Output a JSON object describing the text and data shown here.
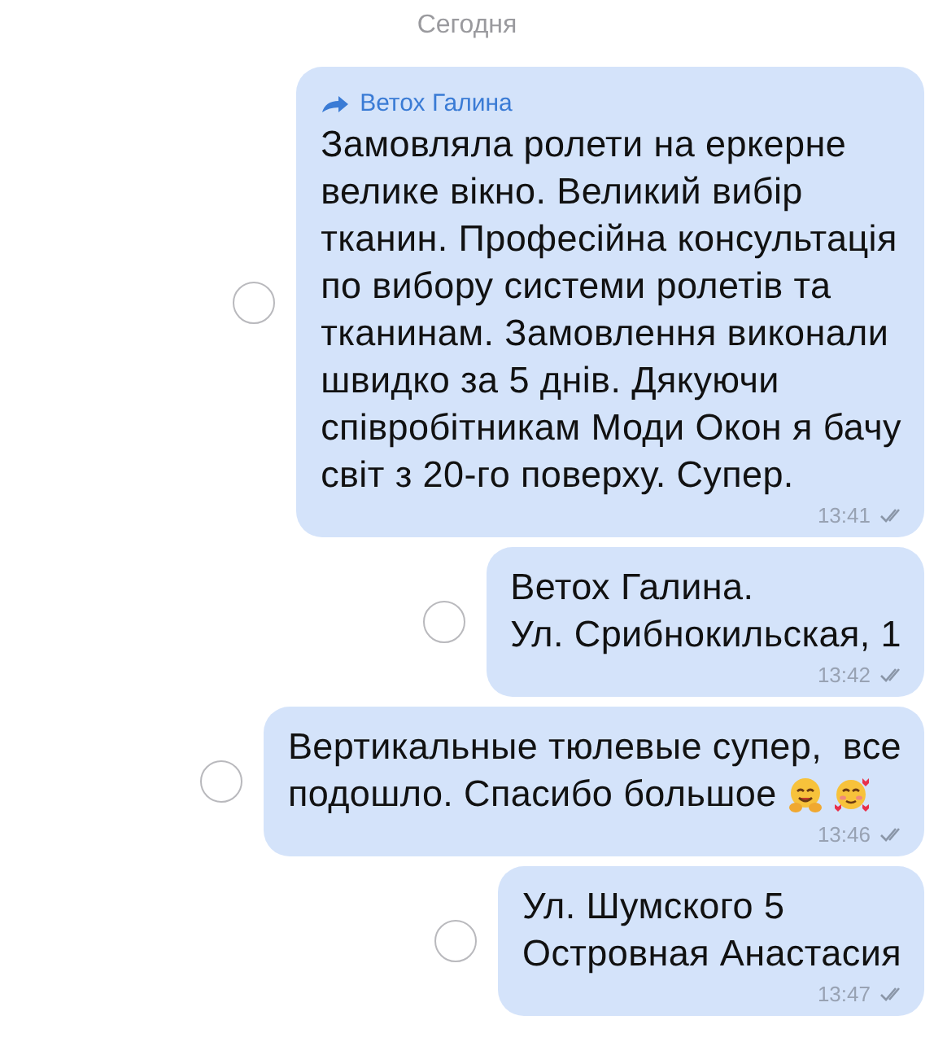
{
  "date_header": "Сегодня",
  "messages": [
    {
      "forwarded_from": "Ветох Галина",
      "text": "Замовляла ролети на еркерне\nвелике вікно. Великий вибір\nтканин. Професійна консультація\nпо вибору системи ролетів та\nтканинам. Замовлення виконали\nшвидко за 5 днів. Дякуючи\nспівробітникам Моди Окон я бачу\nсвіт з 20-го поверху. Супер.",
      "time": "13:41",
      "read": true,
      "selected": false
    },
    {
      "text": "Ветох Галина.\nУл. Срибнокильская, 1",
      "time": "13:42",
      "read": true,
      "selected": false
    },
    {
      "text": "Вертикальные тюлевые супер,  все\nподошло. Спасибо большое",
      "emojis": [
        {
          "kind": "hug"
        },
        {
          "kind": "hearts"
        }
      ],
      "time": "13:46",
      "read": true,
      "selected": false
    },
    {
      "text": "Ул. Шумского 5\nОстровная Анастасия",
      "time": "13:47",
      "read": true,
      "selected": false
    }
  ]
}
